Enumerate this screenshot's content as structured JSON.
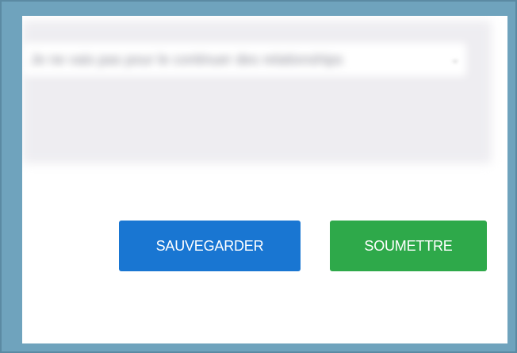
{
  "form": {
    "blurred_select_text": "Je ne vais pas pour le continuer des relationships",
    "blurred_select_chevron": "⌄"
  },
  "actions": {
    "save_label": "SAUVEGARDER",
    "submit_label": "SOUMETTRE"
  },
  "colors": {
    "frame": "#6fa3bd",
    "save_button": "#1976d2",
    "submit_button": "#2ea94a"
  }
}
